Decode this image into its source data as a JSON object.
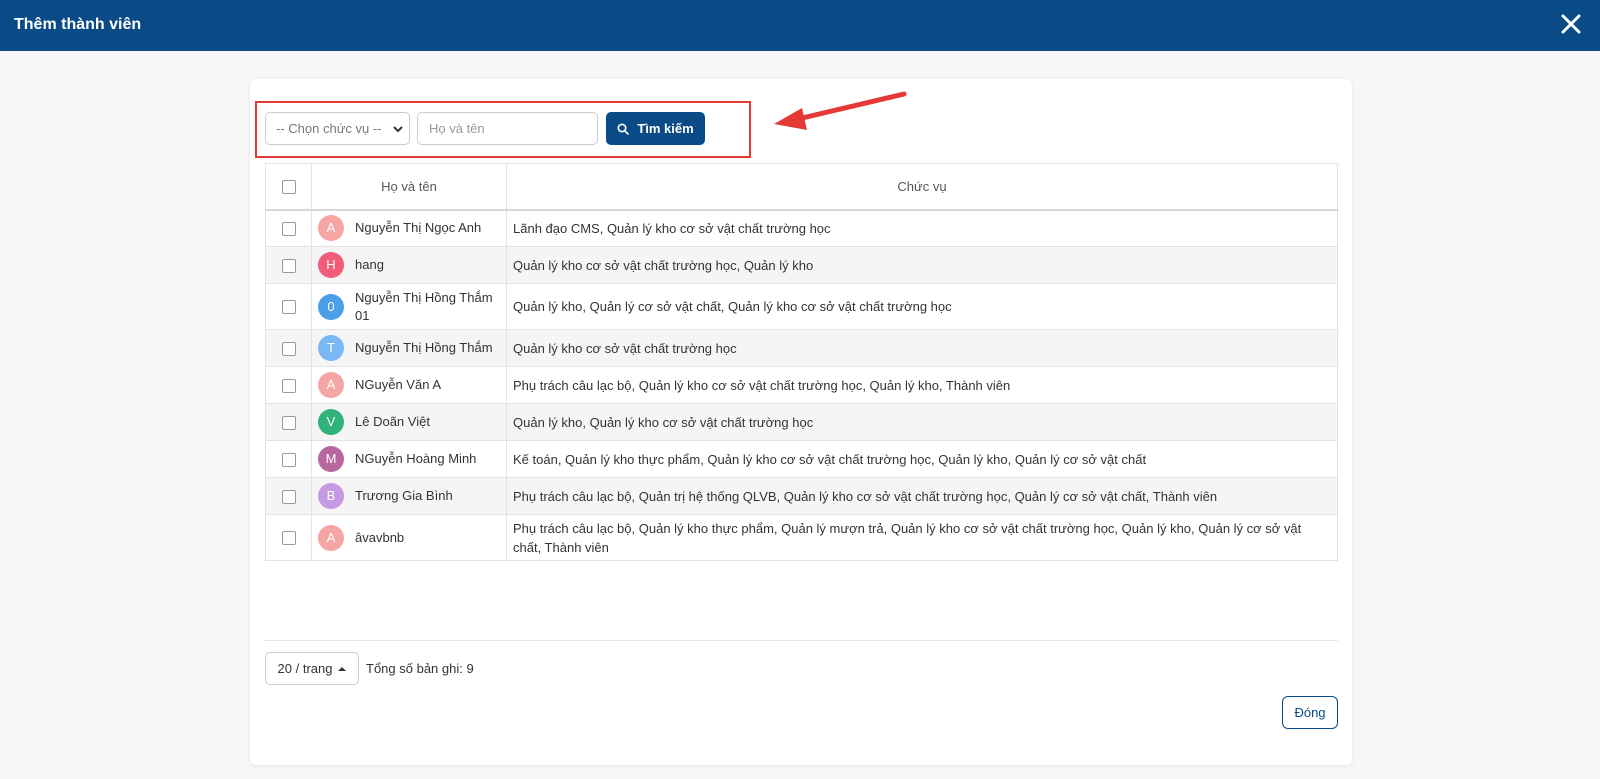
{
  "window": {
    "title": "Thêm thành viên"
  },
  "filters": {
    "position_select": "-- Chọn chức vụ --",
    "name_placeholder": "Họ và tên",
    "search_label": "Tìm kiếm"
  },
  "table": {
    "headers": {
      "name": "Họ và tên",
      "role": "Chức vụ"
    },
    "rows": [
      {
        "initial": "A",
        "avatar_color": "#f6a5a5",
        "name": "Nguyễn Thị Ngọc Anh",
        "roles": "Lãnh đạo CMS, Quản lý kho cơ sở vật chất trường học"
      },
      {
        "initial": "H",
        "avatar_color": "#f25c78",
        "name": "hang",
        "roles": "Quản lý kho cơ sở vật chất trường học, Quản lý kho"
      },
      {
        "initial": "0",
        "avatar_color": "#4a9fe8",
        "name": "Nguyễn Thị Hồng Thắm 01",
        "roles": "Quản lý kho, Quản lý cơ sở vật chất, Quản lý kho cơ sở vật chất trường học"
      },
      {
        "initial": "T",
        "avatar_color": "#7ab8f5",
        "name": "Nguyễn Thị Hồng Thắm",
        "roles": "Quản lý kho cơ sở vật chất trường học"
      },
      {
        "initial": "A",
        "avatar_color": "#f6a5a5",
        "name": "NGuyễn Văn A",
        "roles": "Phụ trách câu lạc bộ, Quản lý kho cơ sở vật chất trường học, Quản lý kho, Thành viên"
      },
      {
        "initial": "V",
        "avatar_color": "#2fb37a",
        "name": "Lê Doãn Việt",
        "roles": "Quản lý kho, Quản lý kho cơ sở vật chất trường học"
      },
      {
        "initial": "M",
        "avatar_color": "#b7679e",
        "name": "NGuyễn Hoàng Minh",
        "roles": "Kế toán, Quản lý kho thực phẩm, Quản lý kho cơ sở vật chất trường học, Quản lý kho, Quản lý cơ sở vật chất"
      },
      {
        "initial": "B",
        "avatar_color": "#c59ae3",
        "name": "Trương Gia Bình",
        "roles": "Phụ trách câu lạc bộ, Quản trị hệ thống QLVB, Quản lý kho cơ sở vật chất trường học, Quản lý cơ sở vật chất, Thành viên"
      },
      {
        "initial": "A",
        "avatar_color": "#f6a5a5",
        "name": "âvavbnb",
        "roles": "Phụ trách câu lạc bộ, Quản lý kho thực phẩm, Quản lý mượn trả, Quản lý kho cơ sở vật chất trường học, Quản lý kho, Quản lý cơ sở vật chất, Thành viên"
      }
    ]
  },
  "footer": {
    "page_size": "20 / trang",
    "total": "Tổng số bản ghi: 9",
    "close_label": "Đóng"
  },
  "colors": {
    "primary": "#0a4b87",
    "highlight": "#e53935"
  }
}
